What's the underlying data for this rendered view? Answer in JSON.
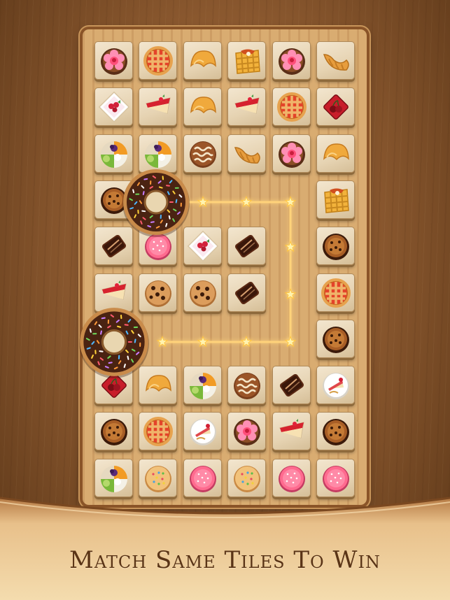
{
  "tagline": "Match Same Tiles To Win",
  "grid": [
    [
      "flower-tart",
      "pie",
      "fortune-cookie",
      "waffle",
      "flower-tart",
      "croissant"
    ],
    [
      "cake-square",
      "cake-slice",
      "fortune-cookie",
      "cake-slice",
      "pie",
      "cherry-candy"
    ],
    [
      "fruit-tart",
      "fruit-tart",
      "choco-cookie",
      "croissant",
      "flower-tart",
      "fortune-cookie"
    ],
    [
      "muffin",
      "",
      "",
      "",
      "",
      "waffle"
    ],
    [
      "chocolate",
      "pink-macaron",
      "cake-square",
      "chocolate",
      "",
      "muffin"
    ],
    [
      "cake-slice",
      "cookie",
      "cookie",
      "chocolate",
      "",
      "pie"
    ],
    [
      "",
      "",
      "",
      "",
      "",
      "muffin"
    ],
    [
      "cherry-candy",
      "fortune-cookie",
      "fruit-tart",
      "choco-cookie",
      "chocolate",
      "cake-plate"
    ],
    [
      "muffin",
      "pie",
      "cake-plate",
      "flower-tart",
      "cake-slice",
      "muffin"
    ],
    [
      "fruit-tart",
      "sugar-cookie",
      "pink-macaron",
      "sugar-cookie",
      "pink-macaron",
      "pink-macaron"
    ]
  ],
  "matched_pair": "donut",
  "colors": {
    "board": "#d9ac71",
    "tile": "#efe0c4",
    "glow": "#ffd27a",
    "text": "#5a3416"
  }
}
